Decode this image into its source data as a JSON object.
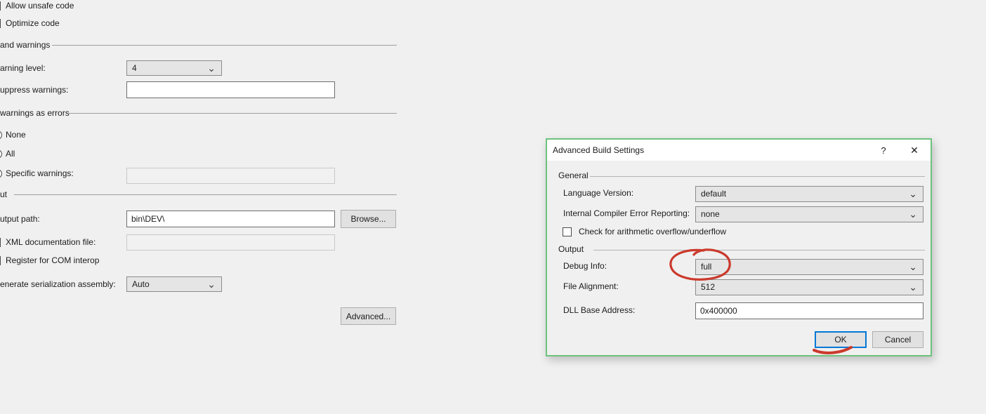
{
  "icons": {
    "chevron_down": "⌄",
    "help": "?",
    "close": "✕"
  },
  "colors": {
    "annotation_red": "#cb3a2c",
    "dialog_border_green": "#6ec27e",
    "ok_focus_blue": "#0078d7"
  },
  "build_page": {
    "allow_unsafe": "Allow unsafe code",
    "optimize_code": "Optimize code",
    "errors_warnings_header": "and warnings",
    "warning_level_label": "arning level:",
    "warning_level_value": "4",
    "suppress_warnings_label": "uppress warnings:",
    "suppress_warnings_value": "",
    "treat_warnings_header": "warnings as errors",
    "radio_none": "None",
    "radio_all": "All",
    "radio_specific": "Specific warnings:",
    "specific_warnings_value": "",
    "output_header": "ut",
    "output_path_label": "utput path:",
    "output_path_value": "bin\\DEV\\",
    "browse_button": "Browse...",
    "xml_doc_label": "XML documentation file:",
    "xml_doc_value": "",
    "com_interop_label": "Register for COM interop",
    "serialization_label": "enerate serialization assembly:",
    "serialization_value": "Auto",
    "advanced_button": "Advanced..."
  },
  "dialog": {
    "title": "Advanced Build Settings",
    "general_group": "General",
    "language_version_label": "Language Version:",
    "language_version_value": "default",
    "ice_reporting_label": "Internal Compiler Error Reporting:",
    "ice_reporting_value": "none",
    "overflow_check_label": "Check for arithmetic overflow/underflow",
    "output_group": "Output",
    "debug_info_label": "Debug Info:",
    "debug_info_value": "full",
    "file_alignment_label": "File Alignment:",
    "file_alignment_value": "512",
    "dll_base_label": "DLL Base Address:",
    "dll_base_value": "0x400000",
    "ok_button": "OK",
    "cancel_button": "Cancel"
  }
}
